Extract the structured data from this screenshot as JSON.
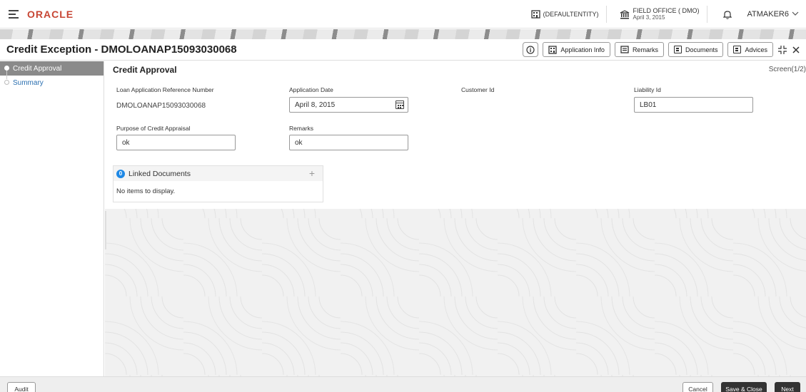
{
  "topbar": {
    "logo": "ORACLE",
    "entity": "(DEFAULTENTITY)",
    "branch_name": "FIELD OFFICE ( DMO)",
    "branch_date": "April 3, 2015",
    "user": "ATMAKER6",
    "colors": {
      "logo": "#c74634"
    }
  },
  "header": {
    "title": "Credit Exception - DMOLOANAP15093030068",
    "info_icon": "info-icon",
    "buttons": {
      "application_info": "Application Info",
      "remarks": "Remarks",
      "documents": "Documents",
      "advices": "Advices"
    }
  },
  "sidebar": {
    "items": [
      {
        "label": "Credit Approval",
        "active": true
      },
      {
        "label": "Summary",
        "active": false
      }
    ]
  },
  "main": {
    "section_title": "Credit Approval",
    "screen_no": "Screen(1/2)",
    "fields": {
      "loan_ref": {
        "label": "Loan Application Reference Number",
        "value": "DMOLOANAP15093030068"
      },
      "app_date": {
        "label": "Application Date",
        "value": "April 8, 2015"
      },
      "customer_id": {
        "label": "Customer Id",
        "value": ""
      },
      "liability_id": {
        "label": "Liability Id",
        "value": "LB01"
      },
      "purpose": {
        "label": "Purpose of Credit Appraisal",
        "value": "ok"
      },
      "remarks": {
        "label": "Remarks",
        "value": "ok"
      }
    },
    "linked_documents": {
      "count": "0",
      "title": "Linked Documents",
      "empty_text": "No items to display."
    }
  },
  "footer": {
    "audit": "Audit",
    "cancel": "Cancel",
    "save_close": "Save & Close",
    "next": "Next"
  }
}
